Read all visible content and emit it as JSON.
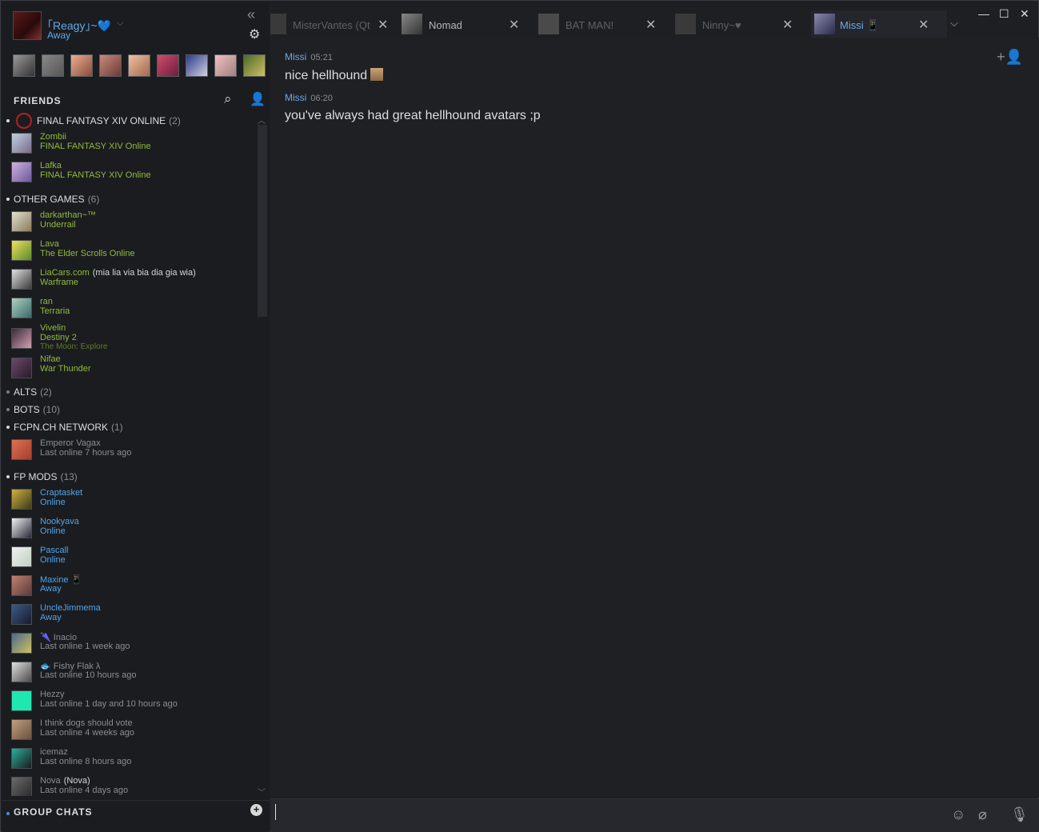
{
  "user": {
    "name": "｢Reagy｣~💙",
    "status": "Away"
  },
  "friends_header": "FRIENDS",
  "groups": [
    {
      "name": "FINAL FANTASY XIV ONLINE",
      "count": "(2)"
    },
    {
      "name": "OTHER GAMES",
      "count": "(6)"
    },
    {
      "name": "ALTS",
      "count": "(2)"
    },
    {
      "name": "BOTS",
      "count": "(10)"
    },
    {
      "name": "FCPN.CH NETWORK",
      "count": "(1)"
    },
    {
      "name": "FP MODS",
      "count": "(13)"
    }
  ],
  "friends": [
    {
      "name": "Zombii",
      "status": "FINAL FANTASY XIV Online"
    },
    {
      "name": "Lafka",
      "status": "FINAL FANTASY XIV Online"
    },
    {
      "name": "darkarthan~™",
      "status": "Underrail"
    },
    {
      "name": "Lava",
      "status": "The Elder Scrolls Online"
    },
    {
      "name": "LiaCars.com",
      "nick": "(mia lia via bia dia gia wia)",
      "status": "Warframe"
    },
    {
      "name": "ran",
      "status": "Terraria"
    },
    {
      "name": "Vivelin",
      "status": "Destiny 2",
      "rich": "The Moon: Explore"
    },
    {
      "name": "Nifae",
      "status": "War Thunder"
    },
    {
      "name": "Emperor Vagax",
      "status": "Last online 7 hours ago"
    },
    {
      "name": "Craptasket",
      "status": "Online"
    },
    {
      "name": "Nookyava",
      "status": "Online"
    },
    {
      "name": "Pascall",
      "status": "Online"
    },
    {
      "name": "Maxine 📱",
      "status": "Away"
    },
    {
      "name": "UncleJimmema",
      "status": "Away"
    },
    {
      "name": "🌂 Inacio",
      "status": "Last online 1 week ago"
    },
    {
      "name": "🐟 Fishy Flak λ",
      "status": "Last online 10 hours ago"
    },
    {
      "name": "Hezzy",
      "status": "Last online 1 day and 10 hours ago"
    },
    {
      "name": "I think dogs should vote",
      "status": "Last online 4 weeks ago"
    },
    {
      "name": "icemaz",
      "status": "Last online 8 hours ago"
    },
    {
      "name": "Nova",
      "nick": "(Nova)",
      "status": "Last online 4 days ago"
    }
  ],
  "group_chats": "GROUP CHATS",
  "tabs": [
    {
      "name": "MisterVantes (Qt"
    },
    {
      "name": "Nomad"
    },
    {
      "name": "BAT MAN!"
    },
    {
      "name": "Ninny~♥"
    },
    {
      "name": "Missi 📱"
    }
  ],
  "messages": [
    {
      "author": "Missi",
      "time": "05:21",
      "text": "nice hellhound"
    },
    {
      "author": "Missi",
      "time": "06:20",
      "text": "you've always had great hellhound avatars ;p"
    }
  ]
}
